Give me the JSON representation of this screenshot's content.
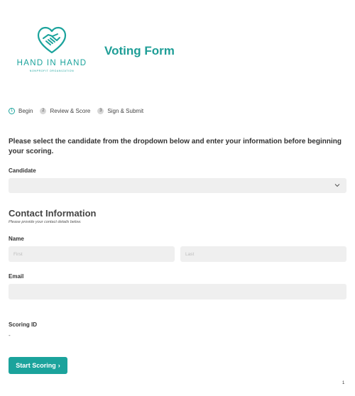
{
  "logo": {
    "name": "HAND IN HAND",
    "tagline": "NONPROFIT ORGANIZATION",
    "icon": "handshake-heart-icon",
    "color": "#1ba39c"
  },
  "form": {
    "title": "Voting Form"
  },
  "steps": [
    {
      "number": "1",
      "label": "Begin",
      "active": true
    },
    {
      "number": "2",
      "label": "Review & Score",
      "active": false
    },
    {
      "number": "3",
      "label": "Sign & Submit",
      "active": false
    }
  ],
  "intro": "Please select the candidate from the dropdown below and enter your information before beginning your scoring.",
  "candidate": {
    "label": "Candidate",
    "value": ""
  },
  "contact": {
    "title": "Contact Information",
    "subtitle": "Please provide your contact details below.",
    "name_label": "Name",
    "first_placeholder": "First",
    "last_placeholder": "Last",
    "email_label": "Email"
  },
  "scoring": {
    "label": "Scoring ID",
    "value": "-"
  },
  "start_button": {
    "label": "Start Scoring",
    "arrow": "›"
  },
  "page_number": "1",
  "colors": {
    "accent": "#1ba39c",
    "field_bg": "#efefef"
  }
}
